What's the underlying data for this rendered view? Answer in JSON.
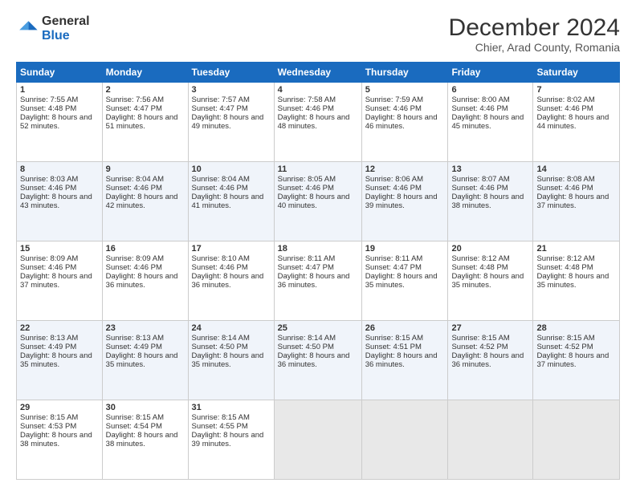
{
  "header": {
    "logo_general": "General",
    "logo_blue": "Blue",
    "main_title": "December 2024",
    "subtitle": "Chier, Arad County, Romania"
  },
  "weekdays": [
    "Sunday",
    "Monday",
    "Tuesday",
    "Wednesday",
    "Thursday",
    "Friday",
    "Saturday"
  ],
  "weeks": [
    [
      {
        "day": "1",
        "sunrise": "7:55 AM",
        "sunset": "4:48 PM",
        "daylight": "8 hours and 52 minutes."
      },
      {
        "day": "2",
        "sunrise": "7:56 AM",
        "sunset": "4:47 PM",
        "daylight": "8 hours and 51 minutes."
      },
      {
        "day": "3",
        "sunrise": "7:57 AM",
        "sunset": "4:47 PM",
        "daylight": "8 hours and 49 minutes."
      },
      {
        "day": "4",
        "sunrise": "7:58 AM",
        "sunset": "4:46 PM",
        "daylight": "8 hours and 48 minutes."
      },
      {
        "day": "5",
        "sunrise": "7:59 AM",
        "sunset": "4:46 PM",
        "daylight": "8 hours and 46 minutes."
      },
      {
        "day": "6",
        "sunrise": "8:00 AM",
        "sunset": "4:46 PM",
        "daylight": "8 hours and 45 minutes."
      },
      {
        "day": "7",
        "sunrise": "8:02 AM",
        "sunset": "4:46 PM",
        "daylight": "8 hours and 44 minutes."
      }
    ],
    [
      {
        "day": "8",
        "sunrise": "8:03 AM",
        "sunset": "4:46 PM",
        "daylight": "8 hours and 43 minutes."
      },
      {
        "day": "9",
        "sunrise": "8:04 AM",
        "sunset": "4:46 PM",
        "daylight": "8 hours and 42 minutes."
      },
      {
        "day": "10",
        "sunrise": "8:04 AM",
        "sunset": "4:46 PM",
        "daylight": "8 hours and 41 minutes."
      },
      {
        "day": "11",
        "sunrise": "8:05 AM",
        "sunset": "4:46 PM",
        "daylight": "8 hours and 40 minutes."
      },
      {
        "day": "12",
        "sunrise": "8:06 AM",
        "sunset": "4:46 PM",
        "daylight": "8 hours and 39 minutes."
      },
      {
        "day": "13",
        "sunrise": "8:07 AM",
        "sunset": "4:46 PM",
        "daylight": "8 hours and 38 minutes."
      },
      {
        "day": "14",
        "sunrise": "8:08 AM",
        "sunset": "4:46 PM",
        "daylight": "8 hours and 37 minutes."
      }
    ],
    [
      {
        "day": "15",
        "sunrise": "8:09 AM",
        "sunset": "4:46 PM",
        "daylight": "8 hours and 37 minutes."
      },
      {
        "day": "16",
        "sunrise": "8:09 AM",
        "sunset": "4:46 PM",
        "daylight": "8 hours and 36 minutes."
      },
      {
        "day": "17",
        "sunrise": "8:10 AM",
        "sunset": "4:46 PM",
        "daylight": "8 hours and 36 minutes."
      },
      {
        "day": "18",
        "sunrise": "8:11 AM",
        "sunset": "4:47 PM",
        "daylight": "8 hours and 36 minutes."
      },
      {
        "day": "19",
        "sunrise": "8:11 AM",
        "sunset": "4:47 PM",
        "daylight": "8 hours and 35 minutes."
      },
      {
        "day": "20",
        "sunrise": "8:12 AM",
        "sunset": "4:48 PM",
        "daylight": "8 hours and 35 minutes."
      },
      {
        "day": "21",
        "sunrise": "8:12 AM",
        "sunset": "4:48 PM",
        "daylight": "8 hours and 35 minutes."
      }
    ],
    [
      {
        "day": "22",
        "sunrise": "8:13 AM",
        "sunset": "4:49 PM",
        "daylight": "8 hours and 35 minutes."
      },
      {
        "day": "23",
        "sunrise": "8:13 AM",
        "sunset": "4:49 PM",
        "daylight": "8 hours and 35 minutes."
      },
      {
        "day": "24",
        "sunrise": "8:14 AM",
        "sunset": "4:50 PM",
        "daylight": "8 hours and 35 minutes."
      },
      {
        "day": "25",
        "sunrise": "8:14 AM",
        "sunset": "4:50 PM",
        "daylight": "8 hours and 36 minutes."
      },
      {
        "day": "26",
        "sunrise": "8:15 AM",
        "sunset": "4:51 PM",
        "daylight": "8 hours and 36 minutes."
      },
      {
        "day": "27",
        "sunrise": "8:15 AM",
        "sunset": "4:52 PM",
        "daylight": "8 hours and 36 minutes."
      },
      {
        "day": "28",
        "sunrise": "8:15 AM",
        "sunset": "4:52 PM",
        "daylight": "8 hours and 37 minutes."
      }
    ],
    [
      {
        "day": "29",
        "sunrise": "8:15 AM",
        "sunset": "4:53 PM",
        "daylight": "8 hours and 38 minutes."
      },
      {
        "day": "30",
        "sunrise": "8:15 AM",
        "sunset": "4:54 PM",
        "daylight": "8 hours and 38 minutes."
      },
      {
        "day": "31",
        "sunrise": "8:15 AM",
        "sunset": "4:55 PM",
        "daylight": "8 hours and 39 minutes."
      },
      null,
      null,
      null,
      null
    ]
  ]
}
